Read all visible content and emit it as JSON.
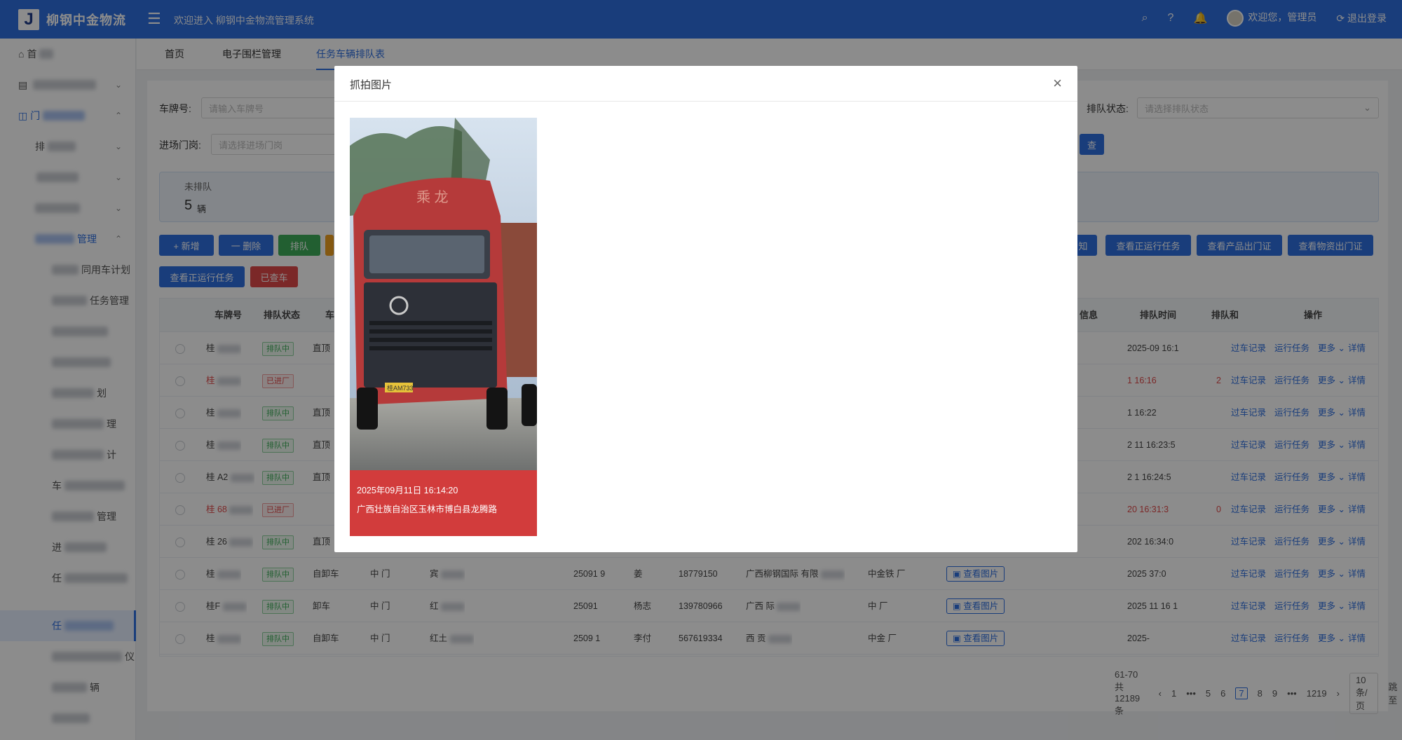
{
  "header": {
    "logo_letter": "J",
    "logo_text": "柳钢中金物流",
    "welcome": "欢迎进入 柳钢中金物流管理系统",
    "user_greeting": "欢迎您，管理员",
    "logout": "退出登录",
    "brand_color": "#2f6fe0"
  },
  "sidebar": {
    "items": [
      {
        "label": "首",
        "icon": "home-icon"
      },
      {
        "label": "电",
        "icon": "menu-icon"
      },
      {
        "label": "门",
        "icon": "grid-icon"
      },
      {
        "label": "排",
        "icon": ""
      },
      {
        "label": "",
        "icon": ""
      },
      {
        "label": "",
        "icon": ""
      },
      {
        "label": "管理",
        "icon": ""
      },
      {
        "label": "同用车计划"
      },
      {
        "label": "任务管理"
      },
      {
        "label": ""
      },
      {
        "label": ""
      },
      {
        "label": "划"
      },
      {
        "label": "理"
      },
      {
        "label": "计"
      },
      {
        "label": "车"
      },
      {
        "label": "管理"
      },
      {
        "label": "进"
      },
      {
        "label": "任"
      },
      {
        "label": "任"
      },
      {
        "label": "仪"
      },
      {
        "label": "辆"
      },
      {
        "label": ""
      }
    ]
  },
  "tabs": [
    "首页",
    "电子围栏管理",
    "任务车辆排队表"
  ],
  "filters": {
    "plate_label": "车牌号:",
    "plate_placeholder": "请输入车牌号",
    "gate_label": "进场门岗:",
    "gate_placeholder": "请选择进场门岗",
    "queue_label": "排队状态:",
    "queue_placeholder": "请选择排队状态"
  },
  "stat": {
    "label": "未排队",
    "value": "5",
    "unit": "辆"
  },
  "buttons": {
    "add": "+ 新增",
    "delete": "一 删除",
    "queue": "排队",
    "notice": "知",
    "running_tasks": "查看正运行任务",
    "product_pass": "查看产品出门证",
    "material_pass": "查看物资出门证",
    "running_tasks2": "查看正运行任务",
    "checked": "已查车",
    "search_partial": "查"
  },
  "table": {
    "headers": [
      "车牌号",
      "排队状态",
      "车",
      "信息",
      "排队时间",
      "排队和",
      "操作"
    ],
    "rows": [
      {
        "plate": "桂",
        "status": "排队中",
        "type": "直顶",
        "time": "2025-09 16:1",
        "red": false,
        "num": ""
      },
      {
        "plate": "桂",
        "status": "已进厂",
        "type": "",
        "time": "1 16:16",
        "red": true,
        "num": "2"
      },
      {
        "plate": "桂",
        "status": "排队中",
        "type": "直顶",
        "time": "1 16:22",
        "red": false,
        "num": ""
      },
      {
        "plate": "桂",
        "status": "排队中",
        "type": "直顶",
        "time": "2 11 16:23:5",
        "red": false,
        "num": ""
      },
      {
        "plate": "桂 A2",
        "status": "排队中",
        "type": "直顶",
        "time": "2 1 16:24:5",
        "red": false,
        "num": ""
      },
      {
        "plate": "桂 68",
        "status": "已进厂",
        "type": "",
        "time": "20 16:31:3",
        "red": true,
        "num": "0"
      },
      {
        "plate": "桂 26",
        "status": "排队中",
        "type": "直顶",
        "time": "202 16:34:0",
        "red": false,
        "num": ""
      },
      {
        "plate": "桂",
        "status": "排队中",
        "type": "自卸车",
        "gate": "中 门",
        "dest": "宾",
        "order": "25091 9",
        "driver": "姜",
        "phone": "18779150",
        "company": "广西柳钢国际 有限",
        "yard": "中金铁 厂",
        "time": "2025 37:0",
        "red": false,
        "num": "",
        "image": "查看图片"
      },
      {
        "plate": "桂F",
        "status": "排队中",
        "type": "卸车",
        "gate": "中 门",
        "dest": "红",
        "order": "25091",
        "driver": "杨志",
        "phone": "139780966",
        "company": "广西 际",
        "yard": "中 厂",
        "time": "2025 11 16 1",
        "red": false,
        "num": "",
        "image": "查看图片"
      },
      {
        "plate": "桂",
        "status": "排队中",
        "type": "自卸车",
        "gate": "中 门",
        "dest": "红土",
        "order": "2509 1",
        "driver": "李付",
        "phone": "567619334",
        "company": "西 贡",
        "yard": "中金 厂",
        "time": "2025-",
        "red": false,
        "num": "",
        "image": "查看图片"
      }
    ],
    "actions": [
      "过车记录",
      "运行任务",
      "更多",
      "详情"
    ]
  },
  "pagination": {
    "range": "61-70 共12189条",
    "pages": [
      "1",
      "•••",
      "5",
      "6",
      "7",
      "8",
      "9",
      "•••",
      "1219"
    ],
    "current": "7",
    "page_size": "10 条/页",
    "jump": "跳至",
    "page_unit": "页"
  },
  "modal": {
    "title": "抓拍图片",
    "photo_time": "2025年09月11日 16:14:20",
    "photo_location": "广西壮族自治区玉林市博白县龙腾路",
    "plate_on_truck": "桂AM733"
  }
}
